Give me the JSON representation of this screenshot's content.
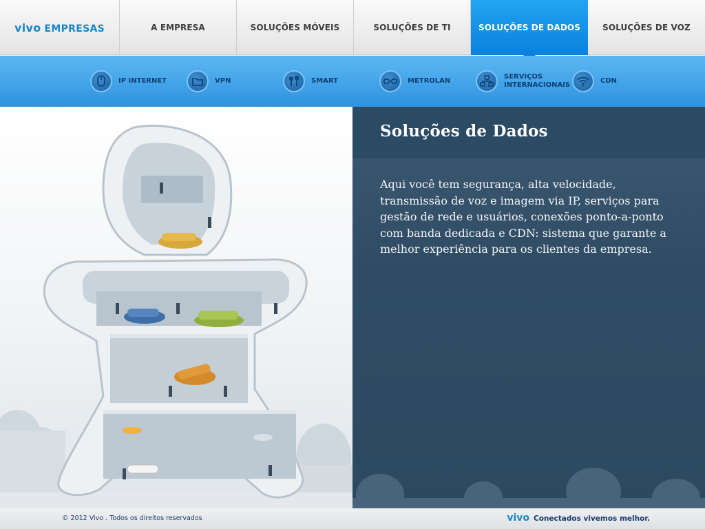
{
  "header": {
    "logo_brand": "vivo",
    "logo_suffix": "EMPRESAS",
    "tabs": [
      {
        "label": "A EMPRESA"
      },
      {
        "label": "SOLUÇÕES MÓVEIS"
      },
      {
        "label": "SOLUÇÕES DE TI"
      },
      {
        "label": "SOLUÇÕES DE DADOS",
        "active": true
      },
      {
        "label": "SOLUÇÕES DE VOZ"
      }
    ]
  },
  "subnav": {
    "items": [
      {
        "label": "IP INTERNET",
        "icon": "mouse-icon"
      },
      {
        "label": "VPN",
        "icon": "folder-icon"
      },
      {
        "label": "SMART",
        "icon": "wrench-screwdriver-icon"
      },
      {
        "label": "METROLAN",
        "icon": "network-link-icon"
      },
      {
        "label": "SERVIÇOS INTERNACIONAIS",
        "icon": "network-nodes-icon"
      },
      {
        "label": "CDN",
        "icon": "wifi-icon"
      }
    ]
  },
  "main": {
    "title": "Soluções de Dados",
    "body": "Aqui você tem segurança, alta velocidade, transmissão de voz e imagem via IP, serviços para gestão de rede e usuários, conexões ponto-a-ponto com banda dedicada e CDN: sistema que garante a melhor experiência para os clientes da empresa."
  },
  "footer": {
    "copyright": "© 2012 Vivo . Todos os direitos reservados",
    "brand": "vivo",
    "slogan": "Conectados vivemos melhor."
  },
  "colors": {
    "accent_blue": "#1a86c8",
    "active_tab": "#0a80dc",
    "panel_bg": "#2f4c64",
    "subnav_bg": "#4aa8ee"
  }
}
